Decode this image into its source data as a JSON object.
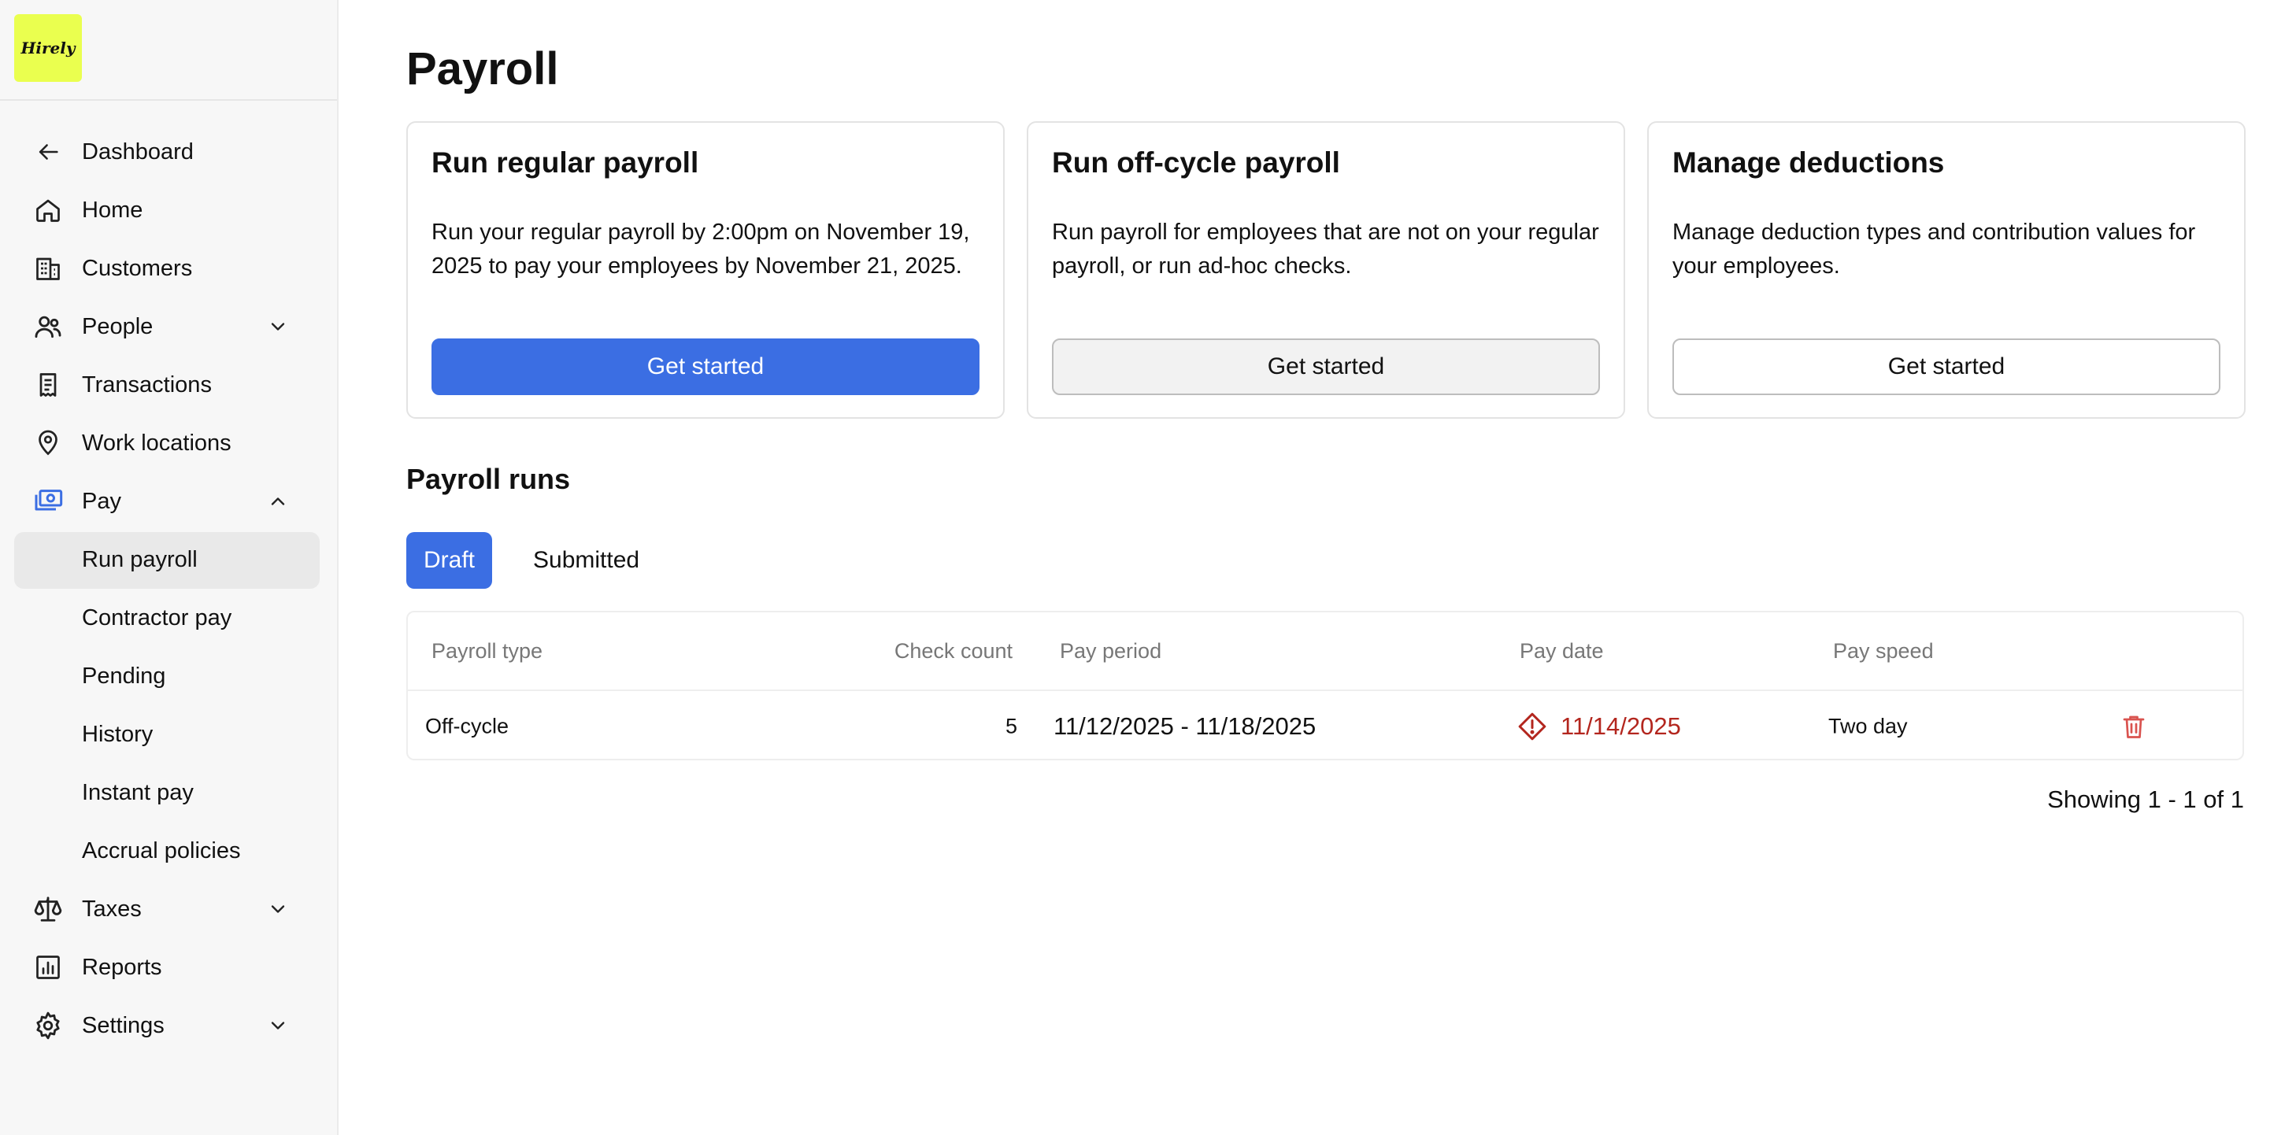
{
  "brand": {
    "logo_text": "Hirely",
    "accent": "#3b6ee3",
    "logo_bg": "#eaff4f",
    "danger": "#b3261e"
  },
  "sidebar": {
    "items": [
      {
        "label": "Dashboard",
        "icon": "arrow-left-icon"
      },
      {
        "label": "Home",
        "icon": "home-icon"
      },
      {
        "label": "Customers",
        "icon": "building-icon"
      },
      {
        "label": "People",
        "icon": "people-icon",
        "expandable": true,
        "expanded": false
      },
      {
        "label": "Transactions",
        "icon": "receipt-icon"
      },
      {
        "label": "Work locations",
        "icon": "map-pin-icon"
      },
      {
        "label": "Pay",
        "icon": "money-icon",
        "expandable": true,
        "expanded": true
      },
      {
        "label": "Taxes",
        "icon": "scale-icon",
        "expandable": true,
        "expanded": false
      },
      {
        "label": "Reports",
        "icon": "chart-icon"
      },
      {
        "label": "Settings",
        "icon": "gear-icon",
        "expandable": true,
        "expanded": false
      }
    ],
    "pay_subitems": [
      {
        "label": "Run payroll",
        "active": true
      },
      {
        "label": "Contractor pay"
      },
      {
        "label": "Pending"
      },
      {
        "label": "History"
      },
      {
        "label": "Instant pay"
      },
      {
        "label": "Accrual policies"
      }
    ]
  },
  "page": {
    "title": "Payroll"
  },
  "cards": [
    {
      "title": "Run regular payroll",
      "description": "Run your regular payroll by 2:00pm on November 19, 2025 to pay your employees by November 21, 2025.",
      "button": "Get started"
    },
    {
      "title": "Run off-cycle payroll",
      "description": "Run payroll for employees that are not on your regular payroll, or run ad-hoc checks.",
      "button": "Get started"
    },
    {
      "title": "Manage deductions",
      "description": "Manage deduction types and contribution values for your employees.",
      "button": "Get started"
    }
  ],
  "payroll_runs": {
    "title": "Payroll runs",
    "tabs": [
      {
        "label": "Draft",
        "active": true
      },
      {
        "label": "Submitted"
      }
    ],
    "columns": {
      "type": "Payroll type",
      "count": "Check count",
      "period": "Pay period",
      "date": "Pay date",
      "speed": "Pay speed"
    },
    "rows": [
      {
        "type": "Off-cycle",
        "count": "5",
        "period": "11/12/2025 - 11/18/2025",
        "date": "11/14/2025",
        "speed": "Two day",
        "date_warning": true
      }
    ],
    "pagination": "Showing 1 - 1 of 1"
  }
}
